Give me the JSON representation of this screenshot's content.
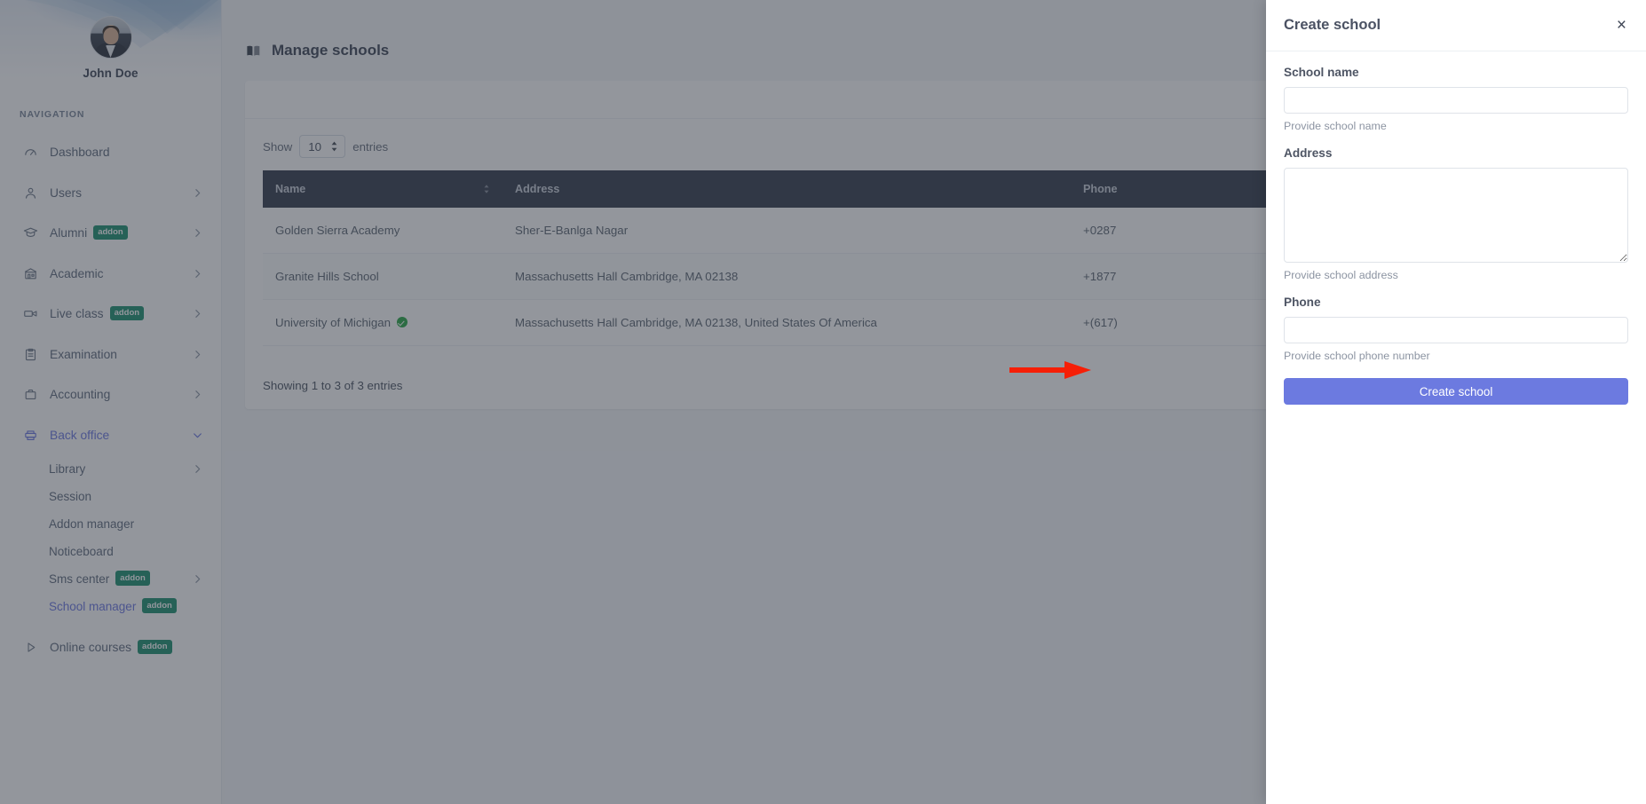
{
  "sidebar": {
    "profile_name": "John Doe",
    "nav_heading": "NAVIGATION",
    "items": [
      {
        "label": "Dashboard",
        "icon": "speedometer-icon",
        "chevron": false,
        "addon": null
      },
      {
        "label": "Users",
        "icon": "user-icon",
        "chevron": true,
        "addon": null
      },
      {
        "label": "Alumni",
        "icon": "graduation-cap-icon",
        "chevron": true,
        "addon": "addon"
      },
      {
        "label": "Academic",
        "icon": "bank-icon",
        "chevron": true,
        "addon": null
      },
      {
        "label": "Live class",
        "icon": "video-camera-icon",
        "chevron": true,
        "addon": "addon"
      },
      {
        "label": "Examination",
        "icon": "clipboard-icon",
        "chevron": true,
        "addon": null
      },
      {
        "label": "Accounting",
        "icon": "briefcase-icon",
        "chevron": true,
        "addon": null
      },
      {
        "label": "Back office",
        "icon": "printer-icon",
        "chevron": true,
        "addon": null,
        "expanded": true,
        "active": true
      }
    ],
    "back_office_children": [
      {
        "label": "Library",
        "chevron": true,
        "addon": null,
        "active": false
      },
      {
        "label": "Session",
        "chevron": false,
        "addon": null,
        "active": false
      },
      {
        "label": "Addon manager",
        "chevron": false,
        "addon": null,
        "active": false
      },
      {
        "label": "Noticeboard",
        "chevron": false,
        "addon": null,
        "active": false
      },
      {
        "label": "Sms center",
        "chevron": true,
        "addon": "addon",
        "active": false
      },
      {
        "label": "School manager",
        "chevron": false,
        "addon": "addon",
        "active": true
      }
    ],
    "items_after": [
      {
        "label": "Online courses",
        "icon": "play-triangle-icon",
        "chevron": false,
        "addon": "addon"
      }
    ]
  },
  "main": {
    "page_title": "Manage schools",
    "page_title_icon": "open-book-icon",
    "datatable": {
      "show_label": "Show",
      "entries_label": "entries",
      "page_length": "10",
      "columns": [
        "Name",
        "Address",
        "Phone"
      ],
      "rows": [
        {
          "name": "Golden Sierra Academy",
          "verified": false,
          "address": "Sher-E-Banlga Nagar",
          "phone": "+0287"
        },
        {
          "name": "Granite Hills School",
          "verified": false,
          "address": "Massachusetts Hall Cambridge, MA 02138",
          "phone": "+1877"
        },
        {
          "name": "University of Michigan",
          "verified": true,
          "address": "Massachusetts Hall Cambridge, MA 02138, United States Of America",
          "phone": "+(617)"
        }
      ],
      "footer_info": "Showing 1 to 3 of 3 entries"
    }
  },
  "offcanvas": {
    "title": "Create school",
    "close_icon": "×",
    "fields": {
      "name_label": "School name",
      "name_value": "",
      "name_help": "Provide school name",
      "address_label": "Address",
      "address_value": "",
      "address_help": "Provide school address",
      "phone_label": "Phone",
      "phone_value": "",
      "phone_help": "Provide school phone number"
    },
    "submit_label": "Create school"
  },
  "annotation": {
    "arrow_color": "#f61f07",
    "points_to": "Create school"
  },
  "colors": {
    "primary": "#6c7ae0",
    "table_header_bg": "#333b4c",
    "addon_badge_bg": "#1d9070",
    "verified_green": "#28a745",
    "page_bg": "#f4f6f9",
    "arrow_red": "#f61f07"
  }
}
